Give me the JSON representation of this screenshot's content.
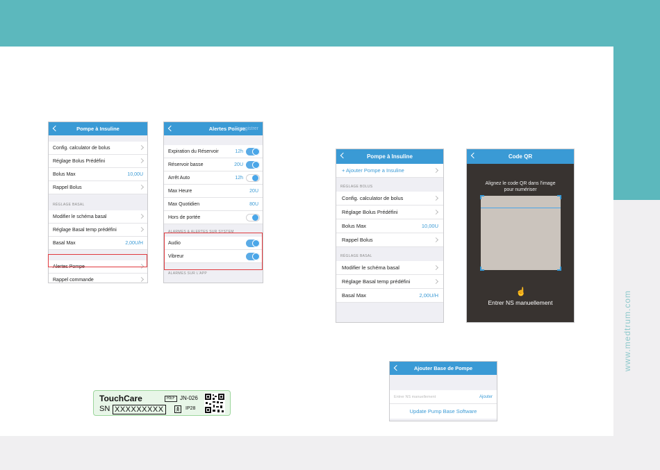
{
  "website": "www.medtrum.com",
  "phone1": {
    "title": "Pompe à Insuline",
    "rows1": [
      {
        "label": "Config. calculator de bolus",
        "value": ""
      },
      {
        "label": "Réglage Bolus Prédéfini",
        "value": ""
      },
      {
        "label": "Bolus Max",
        "value": "10,00U"
      },
      {
        "label": "Rappel Bolus",
        "value": ""
      }
    ],
    "section": "RÉGLAGE BASAL",
    "rows2": [
      {
        "label": "Modifier le schéma basal",
        "value": ""
      },
      {
        "label": "Réglage Basal temp prédéfini",
        "value": ""
      },
      {
        "label": "Basal Max",
        "value": "2,00U/H"
      }
    ],
    "rows3": [
      {
        "label": "Alertes Pompe",
        "value": ""
      },
      {
        "label": "Rappel commande",
        "value": ""
      }
    ]
  },
  "phone2": {
    "title": "Alertes Pompe",
    "saved": "Enregistrer",
    "rows1": [
      {
        "label": "Expiration du Réservoir",
        "value": "12h"
      },
      {
        "label": "Réservoir basse",
        "value": "20U"
      },
      {
        "label": "Arrêt Auto",
        "value": "12h"
      },
      {
        "label": "Max Heure",
        "value": "20U"
      },
      {
        "label": "Max Quotidien",
        "value": "80U"
      },
      {
        "label": "Hors de portée",
        "value": ""
      }
    ],
    "section1": "ALARMES & ALERTES SUR SYSTEM",
    "rows2": [
      {
        "label": "Audio"
      },
      {
        "label": "Vibreur"
      }
    ],
    "section2": "ALARMES SUR L'APP"
  },
  "phone3": {
    "title": "Pompe à Insuline",
    "add": "+ Ajouter Pompe a Insuline",
    "section1": "RÉGLAGE BOLUS",
    "rows1": [
      {
        "label": "Config. calculator de bolus",
        "value": ""
      },
      {
        "label": "Réglage Bolus Prédéfini",
        "value": ""
      },
      {
        "label": "Bolus Max",
        "value": "10,00U"
      },
      {
        "label": "Rappel Bolus",
        "value": ""
      }
    ],
    "section2": "RÉGLAGE BASAL",
    "rows2": [
      {
        "label": "Modifier le schéma basal",
        "value": ""
      },
      {
        "label": "Réglage Basal temp prédéfini",
        "value": ""
      },
      {
        "label": "Basal Max",
        "value": "2,00U/H"
      }
    ]
  },
  "phone4": {
    "title": "Code QR",
    "message_line1": "Alignez le code QR dans l'image",
    "message_line2": "pour numériser",
    "manual": "Entrer NS manuellement"
  },
  "phone5": {
    "title": "Ajouter Base de Pompe",
    "placeholder": "Entrer NS manuellement",
    "add": "Ajouter",
    "update": "Update Pump  Base Software"
  },
  "label": {
    "brand": "TouchCare",
    "ref": "REF",
    "ref_value": "JN-026",
    "sn": "SN",
    "sn_value": "XXXXXXXXX",
    "ip": "IP28"
  },
  "colors": {
    "teal": "#5cb8bd",
    "nav_blue": "#3a9ad5",
    "highlight": "#e0393d"
  }
}
